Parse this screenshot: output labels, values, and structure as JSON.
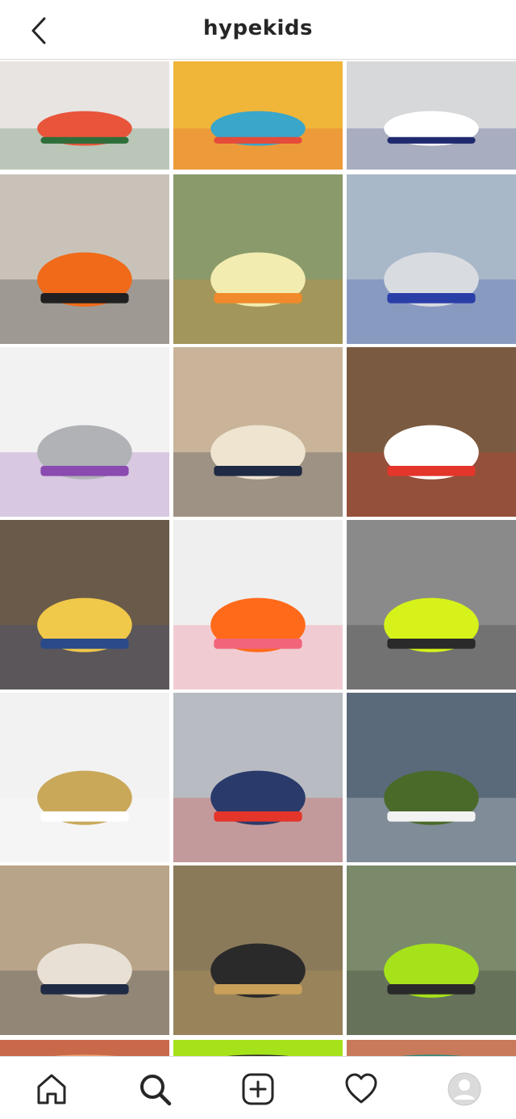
{
  "header": {
    "title": "hypekids",
    "back_icon": "chevron-left-icon"
  },
  "grid": {
    "posts": [
      {
        "name": "post-sneaker-lacing",
        "bg": "#e8e4e2",
        "accent": "#e8553a",
        "accent2": "#2f6e3a"
      },
      {
        "name": "post-baby-playmat",
        "bg": "#f0b63a",
        "accent": "#3aa6c9",
        "accent2": "#e44b3a"
      },
      {
        "name": "post-jordan-five",
        "bg": "#d6d8da",
        "accent": "#ffffff",
        "accent2": "#1f2a6e"
      },
      {
        "name": "post-two-kids-sitting",
        "bg": "#c9c2b8",
        "accent": "#f06a1a",
        "accent2": "#202020"
      },
      {
        "name": "post-yellow-sneakers",
        "bg": "#8a9a6a",
        "accent": "#f2ecb0",
        "accent2": "#f08a2a"
      },
      {
        "name": "post-toddler-grey-suit",
        "bg": "#a9b8c8",
        "accent": "#d8dbe0",
        "accent2": "#2a3ea8"
      },
      {
        "name": "post-air-max-product",
        "bg": "#f2f2f2",
        "accent": "#b0b2b6",
        "accent2": "#8a4ab0"
      },
      {
        "name": "post-toddler-cream-hoodie",
        "bg": "#c9b49a",
        "accent": "#efe4cf",
        "accent2": "#1f2a44"
      },
      {
        "name": "post-infrared-sneakers",
        "bg": "#7a5a40",
        "accent": "#ffffff",
        "accent2": "#e4352a"
      },
      {
        "name": "post-baby-leopard-pants",
        "bg": "#6a5a4a",
        "accent": "#f0c84a",
        "accent2": "#2a4a8a"
      },
      {
        "name": "post-dunk-orange",
        "bg": "#efefef",
        "accent": "#ff6a1a",
        "accent2": "#f2647a"
      },
      {
        "name": "post-neon-jacket",
        "bg": "#8a8a8a",
        "accent": "#d6f21a",
        "accent2": "#2a2a2a"
      },
      {
        "name": "post-metallic-gold-shoe",
        "bg": "#f2f2f2",
        "accent": "#c9a85a",
        "accent2": "#ffffff"
      },
      {
        "name": "post-kid-sunglasses",
        "bg": "#b8bcc2",
        "accent": "#2a3a6a",
        "accent2": "#e4352a"
      },
      {
        "name": "post-vans-socks",
        "bg": "#5a6a7a",
        "accent": "#4a6a2a",
        "accent2": "#f2f2f2"
      },
      {
        "name": "post-toddler-trench",
        "bg": "#b8a488",
        "accent": "#e8e0d4",
        "accent2": "#1f2a44"
      },
      {
        "name": "post-air-force-legs",
        "bg": "#8a7a5a",
        "accent": "#2a2a2a",
        "accent2": "#c9a05a"
      },
      {
        "name": "post-green-beanie",
        "bg": "#7a8a6a",
        "accent": "#a6e21a",
        "accent2": "#2a2a2a"
      },
      {
        "name": "post-partial-1",
        "bg": "#c86a4a",
        "accent": "#f0a070",
        "accent2": "#703020"
      },
      {
        "name": "post-partial-2",
        "bg": "#a6e21a",
        "accent": "#2a2a2a",
        "accent2": "#c9f04a"
      },
      {
        "name": "post-partial-3",
        "bg": "#c87a5a",
        "accent": "#2a8a7a",
        "accent2": "#e0b090"
      }
    ]
  },
  "navbar": {
    "items": [
      {
        "name": "nav-home",
        "icon": "home-icon"
      },
      {
        "name": "nav-search",
        "icon": "search-icon",
        "active": true
      },
      {
        "name": "nav-new-post",
        "icon": "plus-square-icon"
      },
      {
        "name": "nav-activity",
        "icon": "heart-icon"
      },
      {
        "name": "nav-profile",
        "icon": "avatar-icon"
      }
    ]
  }
}
